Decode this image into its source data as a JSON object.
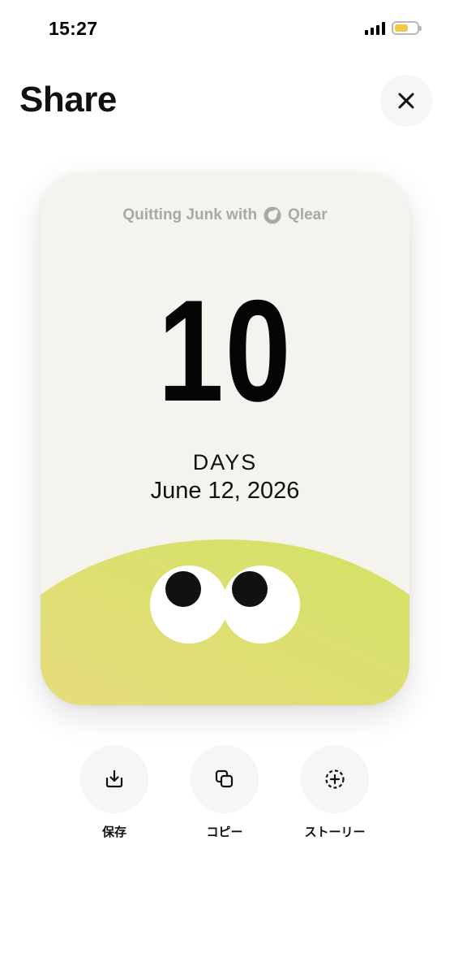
{
  "status_bar": {
    "time": "15:27"
  },
  "header": {
    "title": "Share"
  },
  "card": {
    "brand_prefix": "Quitting Junk with",
    "brand_name": "Qlear",
    "count": "10",
    "unit": "DAYS",
    "date": "June 12, 2026",
    "colors": {
      "background": "#f4f3ee",
      "blob_left": "#e6dc7d",
      "blob_right": "#d3e264"
    }
  },
  "actions": [
    {
      "label": "保存",
      "icon": "download-icon"
    },
    {
      "label": "コピー",
      "icon": "copy-icon"
    },
    {
      "label": "ストーリー",
      "icon": "add-story-icon"
    }
  ]
}
